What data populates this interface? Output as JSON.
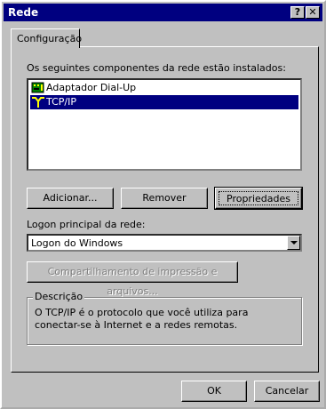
{
  "window": {
    "title": "Rede",
    "help_button": "?",
    "close_button": "✕"
  },
  "tabs": [
    {
      "label": "Configuração"
    }
  ],
  "components": {
    "heading": "Os seguintes componentes da rede estão instalados:",
    "items": [
      {
        "label": "Adaptador Dial-Up",
        "icon": "network-adapter-icon",
        "selected": false
      },
      {
        "label": "TCP/IP",
        "icon": "protocol-icon",
        "selected": true
      }
    ]
  },
  "buttons": {
    "add": "Adicionar...",
    "remove": "Remover",
    "properties": "Propriedades"
  },
  "logon": {
    "label": "Logon principal da rede:",
    "value": "Logon do Windows"
  },
  "sharing_button": "Compartilhamento de impressão e arquivos...",
  "description": {
    "legend": "Descrição",
    "text": "O TCP/IP é o protocolo que você utiliza para conectar-se à Internet e a redes remotas."
  },
  "footer": {
    "ok": "OK",
    "cancel": "Cancelar"
  },
  "colors": {
    "face": "#c0c0c0",
    "title_bar": "#000080",
    "selection": "#000080",
    "disabled_text": "#808080"
  }
}
